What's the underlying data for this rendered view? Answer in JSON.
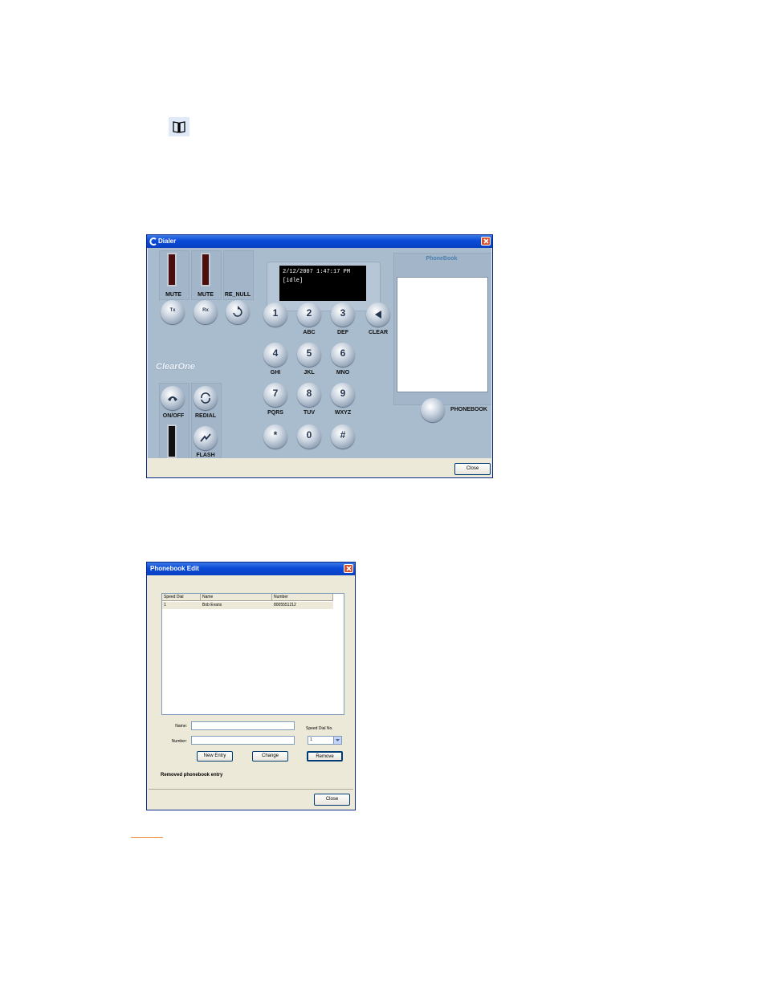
{
  "dialer": {
    "title": "Dialer",
    "display": {
      "line1": "2/12/2007 1:47:17 PM",
      "line2": "[idle]"
    },
    "brand": "ClearOne",
    "mute_tx_label": "MUTE",
    "mute_rx_label": "MUTE",
    "re_null_label": "RE_NULL",
    "tx_button": "Tx",
    "rx_button": "Rx",
    "on_off_label": "ON/OFF",
    "redial_label": "REDIAL",
    "flash_label": "FLASH",
    "clear_label": "CLEAR",
    "phonebook_title": "PhoneBook",
    "phonebook_button_label": "PHONEBOOK",
    "close_label": "Close",
    "keys": [
      {
        "num": "1",
        "letters": ""
      },
      {
        "num": "2",
        "letters": "ABC"
      },
      {
        "num": "3",
        "letters": "DEF"
      },
      {
        "num": "4",
        "letters": "GHI"
      },
      {
        "num": "5",
        "letters": "JKL"
      },
      {
        "num": "6",
        "letters": "MNO"
      },
      {
        "num": "7",
        "letters": "PQRS"
      },
      {
        "num": "8",
        "letters": "TUV"
      },
      {
        "num": "9",
        "letters": "WXYZ"
      },
      {
        "num": "*",
        "letters": ""
      },
      {
        "num": "0",
        "letters": ""
      },
      {
        "num": "#",
        "letters": ""
      }
    ]
  },
  "phonebook_edit": {
    "title": "Phonebook Edit",
    "columns": [
      "Speed Dial",
      "Name",
      "Number"
    ],
    "rows": [
      {
        "speed_dial": "1",
        "name": "Bob Evans",
        "number": "8005551212"
      }
    ],
    "name_label": "Name:",
    "number_label": "Number:",
    "name_value": "",
    "number_value": "",
    "speed_dial_label": "Speed Dial No.",
    "speed_dial_value": "1",
    "new_entry_button": "New Entry",
    "change_button": "Change",
    "remove_button": "Remove",
    "status": "Removed phonebook entry",
    "close_button": "Close"
  }
}
